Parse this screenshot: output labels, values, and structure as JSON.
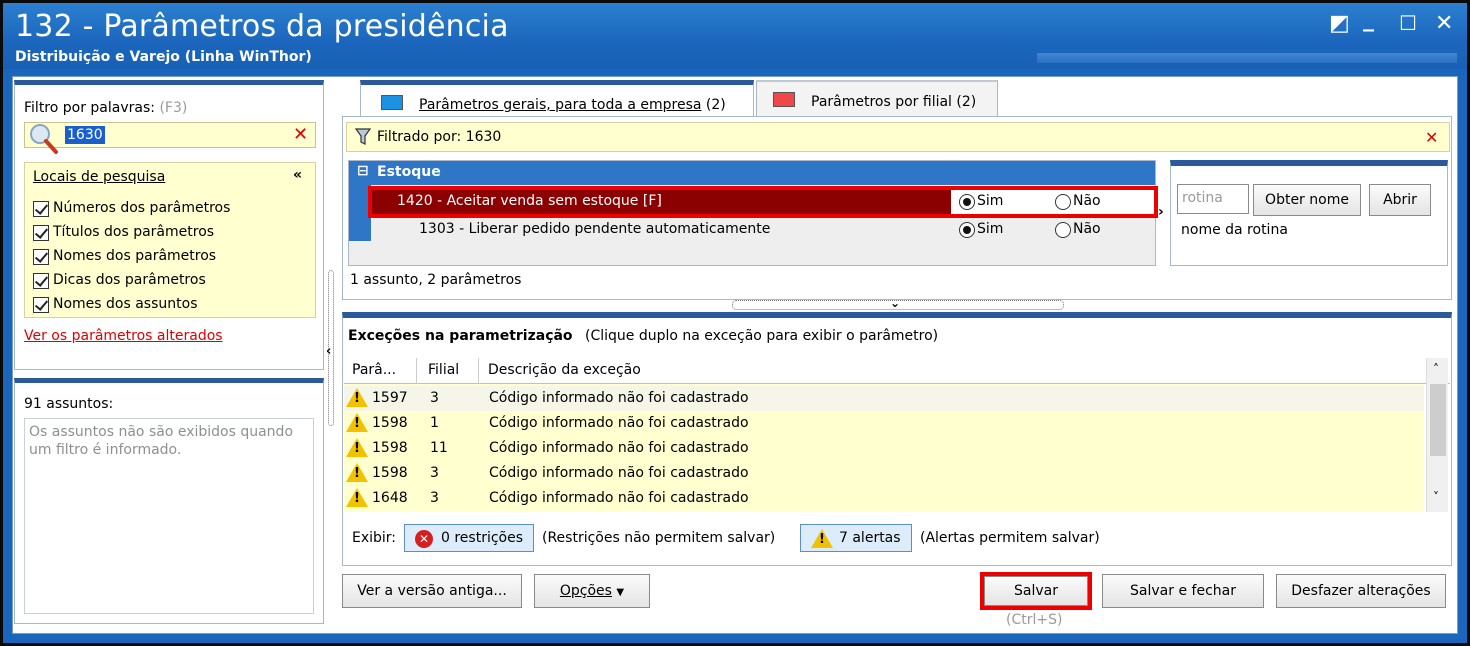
{
  "window": {
    "title": "132 - Parâmetros da presidência",
    "subtitle": "Distribuição e Varejo (Linha WinThor)",
    "controls": [
      "restore-icon",
      "minimize-icon",
      "maximize-icon",
      "close-icon"
    ]
  },
  "left": {
    "filter_label": "Filtro por palavras:",
    "filter_shortcut": "(F3)",
    "search_value": "1630",
    "locais_title": "Locais de pesquisa",
    "checkboxes": [
      {
        "label": "Números dos parâmetros",
        "checked": true
      },
      {
        "label": "Títulos dos parâmetros",
        "checked": true
      },
      {
        "label": "Nomes dos parâmetros",
        "checked": true
      },
      {
        "label": "Dicas dos parâmetros",
        "checked": true
      },
      {
        "label": "Nomes dos assuntos",
        "checked": true
      }
    ],
    "changed_link": "Ver os parâmetros alterados",
    "subjects_count": "91 assuntos:",
    "subjects_info": "Os assuntos não são exibidos quando um filtro é informado."
  },
  "tabs": [
    {
      "label": "Parâmetros gerais, para toda a empresa",
      "count": "(2)",
      "active": true
    },
    {
      "label": "Parâmetros por filial",
      "count": "(2)",
      "active": false
    }
  ],
  "filter_bar": {
    "text": "Filtrado por: 1630"
  },
  "grid": {
    "group": "Estoque",
    "rows": [
      {
        "label": "1420 - Aceitar venda sem estoque [F]",
        "yes": "Sim",
        "no": "Não",
        "value": "Sim",
        "selected": true
      },
      {
        "label": "1303 - Liberar pedido pendente automaticamente",
        "yes": "Sim",
        "no": "Não",
        "value": "Sim",
        "selected": false
      }
    ],
    "summary": "1 assunto, 2 parâmetros"
  },
  "rotina": {
    "placeholder": "rotina",
    "get_name_button": "Obter nome",
    "open_button": "Abrir",
    "name_label": "nome da rotina"
  },
  "exceptions": {
    "title": "Exceções na parametrização",
    "hint": "(Clique duplo na exceção para exibir o parâmetro)",
    "columns": [
      "Parâ...",
      "Filial",
      "Descrição da exceção"
    ],
    "rows": [
      {
        "param": "1597",
        "filial": "3",
        "desc": "Código informado não foi cadastrado"
      },
      {
        "param": "1598",
        "filial": "1",
        "desc": "Código informado não foi cadastrado"
      },
      {
        "param": "1598",
        "filial": "11",
        "desc": "Código informado não foi cadastrado"
      },
      {
        "param": "1598",
        "filial": "3",
        "desc": "Código informado não foi cadastrado"
      },
      {
        "param": "1648",
        "filial": "3",
        "desc": "Código informado não foi cadastrado"
      }
    ],
    "show_label": "Exibir:",
    "restrictions_badge": "0 restrições",
    "restrictions_note": "(Restrições não permitem salvar)",
    "alerts_badge": "7 alertas",
    "alerts_note": "(Alertas permitem salvar)"
  },
  "footer": {
    "old_version": "Ver a versão antiga...",
    "options": "Opções",
    "save": "Salvar",
    "save_shortcut": "(Ctrl+S)",
    "save_close": "Salvar e fechar",
    "undo": "Desfazer alterações"
  }
}
